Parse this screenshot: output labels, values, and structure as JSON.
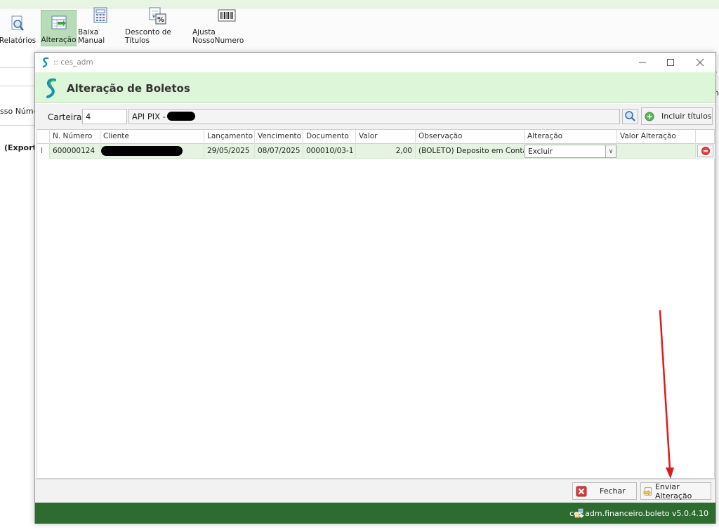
{
  "ribbon": {
    "items": [
      {
        "label": "Relatórios",
        "icon": "report-search-icon"
      },
      {
        "label": "Alteração",
        "icon": "edit-table-icon",
        "active": true
      },
      {
        "label": "Baixa Manual",
        "icon": "calculator-icon"
      },
      {
        "label": "Desconto de Títulos",
        "icon": "discount-percent-icon"
      },
      {
        "label": "Ajusta NossoNumero",
        "icon": "barcode-icon"
      }
    ]
  },
  "background": {
    "left_label": "sso Núme",
    "left_bold": "(Exporta"
  },
  "dialog": {
    "window_title": ":: ces_adm",
    "header_title": "Alteração de Boletos",
    "filter": {
      "carteira_label": "Carteira:",
      "carteira_value": "4",
      "carteira_name": "API PIX -",
      "include_button": "Incluir títulos"
    },
    "grid": {
      "columns": [
        "N. Número",
        "Cliente",
        "Lançamento",
        "Vencimento",
        "Documento",
        "Valor",
        "Observação",
        "Alteração",
        "Valor Alteração"
      ],
      "rows": [
        {
          "indicator": "I",
          "numero": "600000124",
          "cliente": "",
          "lancamento": "29/05/2025",
          "vencimento": "08/07/2025",
          "documento": "000010/03-1",
          "valor": "2,00",
          "observacao": "(BOLETO) Deposito em Conta ...",
          "alteracao": "Excluir",
          "valor_alteracao": ""
        }
      ]
    },
    "footer": {
      "close_button": "Fechar",
      "send_button": "Enviar Alteração"
    },
    "statusbar": {
      "version": "ces.adm.financeiro.boleto v5.0.4.10"
    }
  },
  "colors": {
    "header_bg": "#ddf5d8",
    "selected_row": "#e6f3e2",
    "statusbar": "#2e6b30",
    "annotation_arrow": "#e01b1b"
  }
}
